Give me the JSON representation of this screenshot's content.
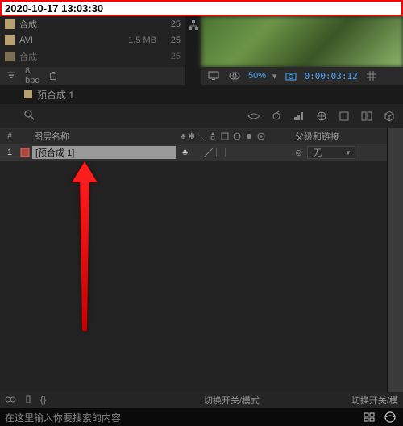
{
  "timestamp": "2020-10-17 13:03:30",
  "project": {
    "assets": [
      {
        "name": "合成",
        "type": "comp",
        "size": "",
        "num": "25"
      },
      {
        "name": "AVI",
        "type": "comp",
        "size": "1.5 MB",
        "num": "25"
      },
      {
        "name": "合成",
        "type": "comp",
        "size": "",
        "num": "25"
      }
    ],
    "bpc": "8 bpc"
  },
  "preview": {
    "zoom": "50%",
    "timecode": "0:00:03:12"
  },
  "timeline": {
    "tab_name": "预合成 1",
    "header_num": "#",
    "header_name": "图层名称",
    "header_parent": "父级和链接",
    "layer": {
      "index": "1",
      "name": "[预合成 1]",
      "parent_value": "无"
    },
    "footer_mode": "切换开关/模式",
    "footer_mode_right": "切换开关/模"
  },
  "taskbar": {
    "hint": "在这里输入你要搜索的内容"
  }
}
